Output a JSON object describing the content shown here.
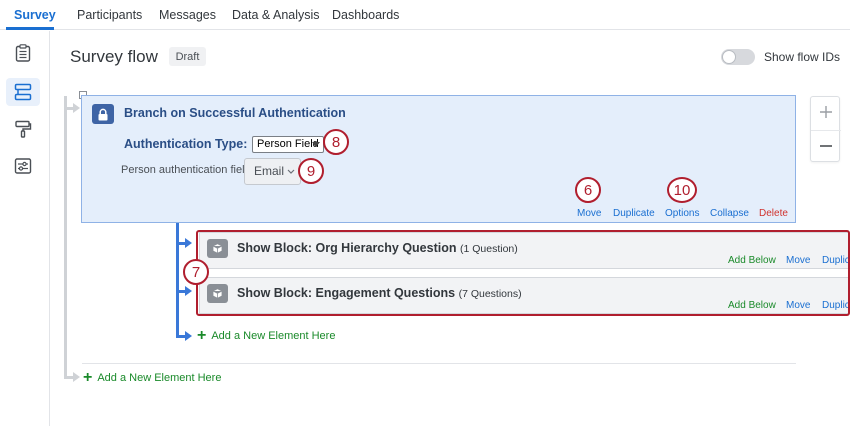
{
  "nav": {
    "tabs": [
      {
        "label": "Survey",
        "active": true
      },
      {
        "label": "Participants"
      },
      {
        "label": "Messages"
      },
      {
        "label": "Data & Analysis"
      },
      {
        "label": "Dashboards"
      }
    ]
  },
  "rail": {
    "icons": [
      "survey-icon",
      "survey-flow-icon",
      "look-and-feel-icon",
      "survey-options-icon"
    ],
    "active": "survey-flow-icon"
  },
  "header": {
    "title": "Survey flow",
    "status_badge": "Draft",
    "toggle_label": "Show flow IDs",
    "toggle_on": false
  },
  "branch": {
    "title": "Branch on Successful Authentication",
    "auth_type_label": "Authentication Type:",
    "auth_type_value": "Person Field",
    "person_field_label": "Person authentication field:",
    "person_field_value": "Email",
    "actions": {
      "move": "Move",
      "duplicate": "Duplicate",
      "options": "Options",
      "collapse": "Collapse",
      "delete": "Delete"
    }
  },
  "blocks": [
    {
      "title": "Show Block: Org Hierarchy Question",
      "count": "(1 Question)",
      "add_below": "Add Below",
      "move": "Move",
      "duplicate": "Duplic"
    },
    {
      "title": "Show Block: Engagement Questions",
      "count": "(7 Questions)",
      "add_below": "Add Below",
      "move": "Move",
      "duplicate": "Duplic"
    }
  ],
  "add_element": {
    "inner": "Add a New Element Here",
    "outer": "Add a New Element Here"
  },
  "callouts": {
    "c6": "6",
    "c7": "7",
    "c8": "8",
    "c9": "9",
    "c10": "10"
  },
  "colors": {
    "accent": "#1a6fd1",
    "branch_bg": "#e4eefb",
    "branch_title": "#2a4e86",
    "add_green": "#1a8a2a",
    "delete_red": "#d0312d",
    "callout_red": "#b01e2e",
    "connector_blue": "#3a78d8",
    "connector_gray": "#cfd2d6"
  }
}
